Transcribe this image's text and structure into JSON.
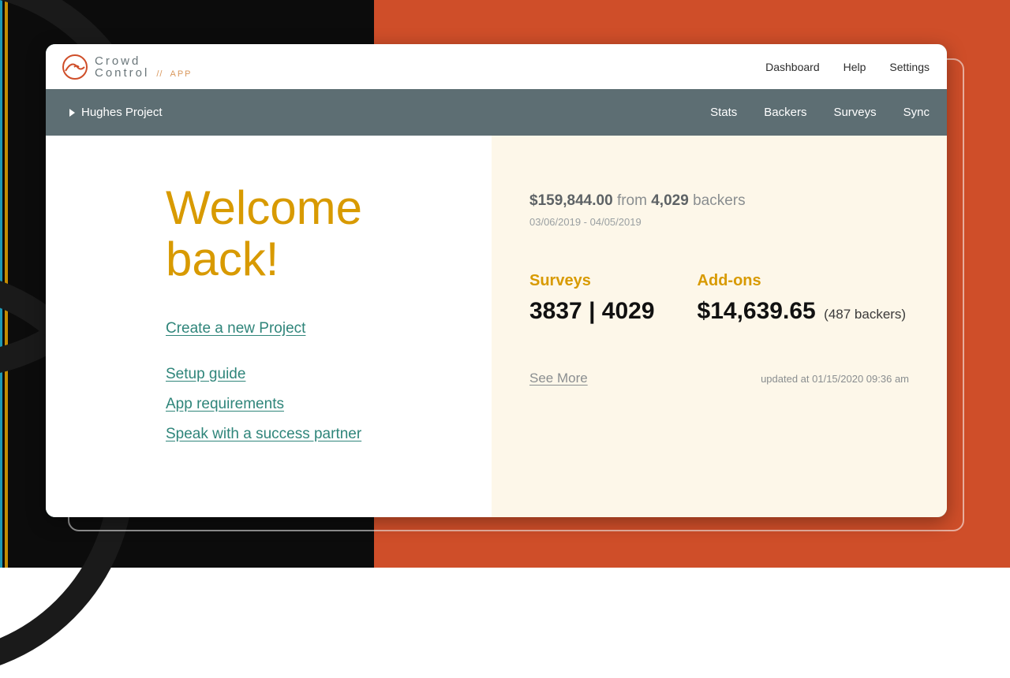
{
  "brand": {
    "line1": "Crowd",
    "line2": "Control",
    "sep": "//",
    "app": "APP"
  },
  "topnav": {
    "dashboard": "Dashboard",
    "help": "Help",
    "settings": "Settings"
  },
  "project": {
    "name": "Hughes Project"
  },
  "tabs": {
    "stats": "Stats",
    "backers": "Backers",
    "surveys": "Surveys",
    "sync": "Sync"
  },
  "welcome": {
    "line1": "Welcome",
    "line2": "back!"
  },
  "links": {
    "create": "Create a new Project",
    "setup": "Setup guide",
    "requirements": "App requirements",
    "partner": "Speak with a success partner"
  },
  "summary": {
    "amount": "$159,844.00",
    "from_word": "from",
    "backers_count": "4,029",
    "backers_word": "backers",
    "date_range": "03/06/2019 - 04/05/2019"
  },
  "stats": {
    "surveys_label": "Surveys",
    "surveys_value": "3837 | 4029",
    "addons_label": "Add-ons",
    "addons_value": "$14,639.65",
    "addons_backers": "(487 backers)"
  },
  "footer": {
    "see_more": "See More",
    "updated": "updated at 01/15/2020 09:36 am"
  }
}
